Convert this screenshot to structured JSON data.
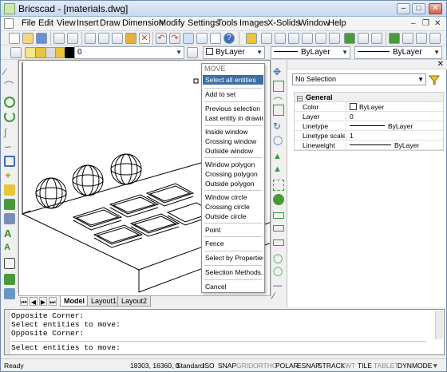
{
  "window": {
    "title": "Bricscad - [materials.dwg]"
  },
  "menu": [
    "File",
    "Edit",
    "View",
    "Insert",
    "Draw",
    "Dimension",
    "Modify",
    "Settings",
    "Tools",
    "Images",
    "X-Solids",
    "Window",
    "Help"
  ],
  "toolbar2": {
    "layer": "0",
    "color": "ByLayer",
    "linetype": "ByLayer",
    "lineweight": "ByLayer"
  },
  "context_menu": {
    "header": "MOVE",
    "items": [
      {
        "label": "Select all entities",
        "selected": true
      },
      {
        "label": "Add to set"
      },
      {
        "label": "Previous selection"
      },
      {
        "label": "Last entity in drawing"
      },
      {
        "label": "Inside window"
      },
      {
        "label": "Crossing window"
      },
      {
        "label": "Outside window"
      },
      {
        "label": "Window polygon"
      },
      {
        "label": "Crossing polygon"
      },
      {
        "label": "Outside polygon"
      },
      {
        "label": "Window circle"
      },
      {
        "label": "Crossing circle"
      },
      {
        "label": "Outside circle"
      },
      {
        "label": "Point"
      },
      {
        "label": "Fence"
      },
      {
        "label": "Select by Properties..."
      },
      {
        "label": "Selection Methods..."
      },
      {
        "label": "Cancel"
      }
    ]
  },
  "tabs": [
    "Model",
    "Layout1",
    "Layout2"
  ],
  "properties": {
    "selection": "No Selection",
    "section": "General",
    "rows": [
      {
        "label": "Color",
        "value": "ByLayer",
        "kind": "color"
      },
      {
        "label": "Layer",
        "value": "0",
        "kind": "text"
      },
      {
        "label": "Linetype",
        "value": "ByLayer",
        "kind": "line"
      },
      {
        "label": "Linetype scale",
        "value": "1",
        "kind": "text"
      },
      {
        "label": "Lineweight",
        "value": "ByLayer",
        "kind": "line"
      }
    ]
  },
  "command": {
    "history": [
      "Opposite Corner:",
      "Select entities to move:",
      "Opposite Corner:"
    ],
    "prompt": "Select entities to move:"
  },
  "status": {
    "ready": "Ready",
    "coords": "18303, 16360, 0",
    "fields": [
      {
        "label": "Standard",
        "on": true
      },
      {
        "label": "ISO",
        "on": true
      },
      {
        "label": "SNAP",
        "on": true
      },
      {
        "label": "GRID",
        "on": false
      },
      {
        "label": "ORTHO",
        "on": false
      },
      {
        "label": "POLAR",
        "on": true
      },
      {
        "label": "ESNAP",
        "on": true
      },
      {
        "label": "STRACK",
        "on": true
      },
      {
        "label": "LWT",
        "on": false
      },
      {
        "label": "TILE",
        "on": true
      },
      {
        "label": "TABLET",
        "on": false
      },
      {
        "label": "DYNMODE",
        "on": true
      }
    ]
  },
  "colors": {
    "selection": "#3a6ea5",
    "icon_blue": "#3d6fb6",
    "icon_green": "#4a9a3a",
    "icon_red": "#d03a2a",
    "icon_yellow": "#e8c53a"
  }
}
